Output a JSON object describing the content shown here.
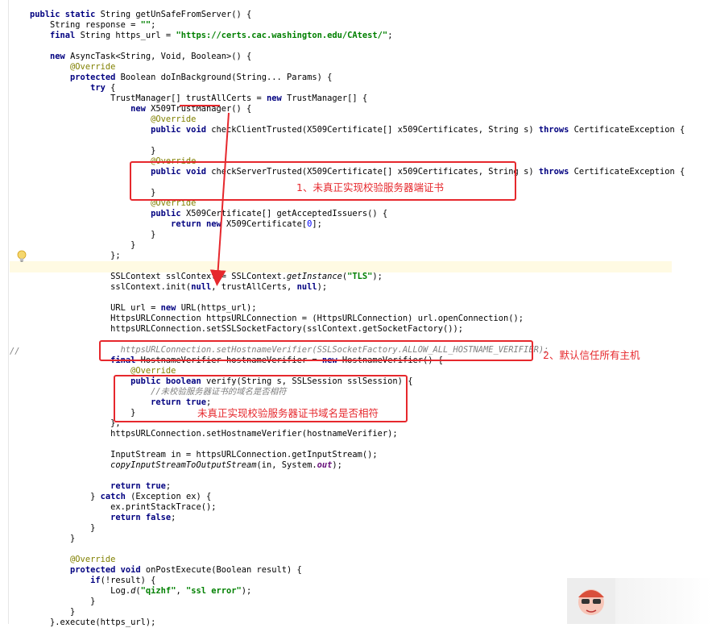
{
  "code_lines": [
    {
      "segments": [
        {
          "t": "public static ",
          "c": "kw"
        },
        {
          "t": "String getUnSafeFromServer() {",
          "c": ""
        }
      ]
    },
    {
      "segments": [
        {
          "t": "    String response = ",
          "c": ""
        },
        {
          "t": "\"\"",
          "c": "str"
        },
        {
          "t": ";",
          "c": ""
        }
      ]
    },
    {
      "segments": [
        {
          "t": "    ",
          "c": ""
        },
        {
          "t": "final ",
          "c": "kw"
        },
        {
          "t": "String https_url = ",
          "c": ""
        },
        {
          "t": "\"https://certs.cac.washington.edu/CAtest/\"",
          "c": "str"
        },
        {
          "t": ";",
          "c": ""
        }
      ]
    },
    {
      "segments": [
        {
          "t": "",
          "c": ""
        }
      ]
    },
    {
      "segments": [
        {
          "t": "    ",
          "c": ""
        },
        {
          "t": "new ",
          "c": "kw"
        },
        {
          "t": "AsyncTask<String, Void, Boolean>() {",
          "c": ""
        }
      ]
    },
    {
      "segments": [
        {
          "t": "        ",
          "c": ""
        },
        {
          "t": "@Override",
          "c": "anno"
        }
      ]
    },
    {
      "segments": [
        {
          "t": "        ",
          "c": ""
        },
        {
          "t": "protected ",
          "c": "kw"
        },
        {
          "t": "Boolean doInBackground(String... Params) {",
          "c": ""
        }
      ]
    },
    {
      "segments": [
        {
          "t": "            ",
          "c": ""
        },
        {
          "t": "try ",
          "c": "kw"
        },
        {
          "t": "{",
          "c": ""
        }
      ]
    },
    {
      "segments": [
        {
          "t": "                TrustManager[] trustAllCerts = ",
          "c": ""
        },
        {
          "t": "new ",
          "c": "kw"
        },
        {
          "t": "TrustManager[] {",
          "c": ""
        }
      ]
    },
    {
      "segments": [
        {
          "t": "                    ",
          "c": ""
        },
        {
          "t": "new ",
          "c": "kw"
        },
        {
          "t": "X509TrustManager() {",
          "c": ""
        }
      ]
    },
    {
      "segments": [
        {
          "t": "                        ",
          "c": ""
        },
        {
          "t": "@Override",
          "c": "anno"
        }
      ]
    },
    {
      "segments": [
        {
          "t": "                        ",
          "c": ""
        },
        {
          "t": "public void ",
          "c": "kw"
        },
        {
          "t": "checkClientTrusted(X509Certificate[] x509Certificates, String s) ",
          "c": ""
        },
        {
          "t": "throws ",
          "c": "kw"
        },
        {
          "t": "CertificateException {",
          "c": ""
        }
      ]
    },
    {
      "segments": [
        {
          "t": "",
          "c": ""
        }
      ]
    },
    {
      "segments": [
        {
          "t": "                        }",
          "c": ""
        }
      ]
    },
    {
      "segments": [
        {
          "t": "                        ",
          "c": ""
        },
        {
          "t": "@Override",
          "c": "anno"
        }
      ]
    },
    {
      "segments": [
        {
          "t": "                        ",
          "c": ""
        },
        {
          "t": "public void ",
          "c": "kw"
        },
        {
          "t": "checkServerTrusted(X509Certificate[] x509Certificates, String s) ",
          "c": ""
        },
        {
          "t": "throws ",
          "c": "kw"
        },
        {
          "t": "CertificateException {",
          "c": ""
        }
      ]
    },
    {
      "segments": [
        {
          "t": "",
          "c": ""
        }
      ]
    },
    {
      "segments": [
        {
          "t": "                        }",
          "c": ""
        }
      ]
    },
    {
      "segments": [
        {
          "t": "                        ",
          "c": ""
        },
        {
          "t": "@Override",
          "c": "anno"
        }
      ]
    },
    {
      "segments": [
        {
          "t": "                        ",
          "c": ""
        },
        {
          "t": "public ",
          "c": "kw"
        },
        {
          "t": "X509Certificate[] getAcceptedIssuers() {",
          "c": ""
        }
      ]
    },
    {
      "segments": [
        {
          "t": "                            ",
          "c": ""
        },
        {
          "t": "return new ",
          "c": "kw"
        },
        {
          "t": "X509Certificate[",
          "c": ""
        },
        {
          "t": "0",
          "c": "num"
        },
        {
          "t": "];",
          "c": ""
        }
      ]
    },
    {
      "segments": [
        {
          "t": "                        }",
          "c": ""
        }
      ]
    },
    {
      "segments": [
        {
          "t": "                    }",
          "c": ""
        }
      ]
    },
    {
      "segments": [
        {
          "t": "                };",
          "c": ""
        }
      ]
    },
    {
      "segments": [
        {
          "t": "",
          "c": ""
        }
      ]
    },
    {
      "segments": [
        {
          "t": "                SSLContext sslContext = SSLContext.",
          "c": ""
        },
        {
          "t": "getInstance",
          "c": "it"
        },
        {
          "t": "(",
          "c": ""
        },
        {
          "t": "\"TLS\"",
          "c": "str"
        },
        {
          "t": ");",
          "c": ""
        }
      ]
    },
    {
      "segments": [
        {
          "t": "                sslContext.init(",
          "c": ""
        },
        {
          "t": "null",
          "c": "kw"
        },
        {
          "t": ", trustAllCerts, ",
          "c": ""
        },
        {
          "t": "null",
          "c": "kw"
        },
        {
          "t": ");",
          "c": ""
        }
      ]
    },
    {
      "segments": [
        {
          "t": "",
          "c": ""
        }
      ]
    },
    {
      "segments": [
        {
          "t": "                URL url = ",
          "c": ""
        },
        {
          "t": "new ",
          "c": "kw"
        },
        {
          "t": "URL(https_url);",
          "c": ""
        }
      ]
    },
    {
      "segments": [
        {
          "t": "                HttpsURLConnection httpsURLConnection = (HttpsURLConnection) url.openConnection();",
          "c": ""
        }
      ]
    },
    {
      "segments": [
        {
          "t": "                httpsURLConnection.setSSLSocketFactory(sslContext.getSocketFactory());",
          "c": ""
        }
      ]
    },
    {
      "segments": [
        {
          "t": "",
          "c": ""
        }
      ]
    },
    {
      "segments": [
        {
          "t": "                  httpsURLConnection.setHostnameVerifier(SSLSocketFactory.ALLOW_ALL_HOSTNAME_VERIFIER);",
          "c": "cmt"
        }
      ]
    },
    {
      "segments": [
        {
          "t": "                ",
          "c": ""
        },
        {
          "t": "final ",
          "c": "kw"
        },
        {
          "t": "HostnameVerifier hostnameVerifier = ",
          "c": ""
        },
        {
          "t": "new ",
          "c": "kw"
        },
        {
          "t": "HostnameVerifier() {",
          "c": ""
        }
      ]
    },
    {
      "segments": [
        {
          "t": "                    ",
          "c": ""
        },
        {
          "t": "@Override",
          "c": "anno"
        }
      ]
    },
    {
      "segments": [
        {
          "t": "                    ",
          "c": ""
        },
        {
          "t": "public boolean ",
          "c": "kw"
        },
        {
          "t": "verify(String s, SSLSession sslSession) {",
          "c": ""
        }
      ]
    },
    {
      "segments": [
        {
          "t": "                        ",
          "c": ""
        },
        {
          "t": "//未校验服务器证书的域名是否相符",
          "c": "cmt"
        }
      ]
    },
    {
      "segments": [
        {
          "t": "                        ",
          "c": ""
        },
        {
          "t": "return true",
          "c": "kw"
        },
        {
          "t": ";",
          "c": ""
        }
      ]
    },
    {
      "segments": [
        {
          "t": "                    }",
          "c": ""
        }
      ]
    },
    {
      "segments": [
        {
          "t": "                };",
          "c": ""
        }
      ]
    },
    {
      "segments": [
        {
          "t": "                httpsURLConnection.setHostnameVerifier(hostnameVerifier);",
          "c": ""
        }
      ]
    },
    {
      "segments": [
        {
          "t": "",
          "c": ""
        }
      ]
    },
    {
      "segments": [
        {
          "t": "                InputStream in = httpsURLConnection.getInputStream();",
          "c": ""
        }
      ]
    },
    {
      "segments": [
        {
          "t": "                ",
          "c": ""
        },
        {
          "t": "copyInputStreamToOutputStream",
          "c": "it"
        },
        {
          "t": "(in, System.",
          "c": ""
        },
        {
          "t": "out",
          "c": "field"
        },
        {
          "t": ");",
          "c": ""
        }
      ]
    },
    {
      "segments": [
        {
          "t": "",
          "c": ""
        }
      ]
    },
    {
      "segments": [
        {
          "t": "                ",
          "c": ""
        },
        {
          "t": "return true",
          "c": "kw"
        },
        {
          "t": ";",
          "c": ""
        }
      ]
    },
    {
      "segments": [
        {
          "t": "            } ",
          "c": ""
        },
        {
          "t": "catch ",
          "c": "kw"
        },
        {
          "t": "(Exception ex) {",
          "c": ""
        }
      ]
    },
    {
      "segments": [
        {
          "t": "                ex.printStackTrace();",
          "c": ""
        }
      ]
    },
    {
      "segments": [
        {
          "t": "                ",
          "c": ""
        },
        {
          "t": "return false",
          "c": "kw"
        },
        {
          "t": ";",
          "c": ""
        }
      ]
    },
    {
      "segments": [
        {
          "t": "            }",
          "c": ""
        }
      ]
    },
    {
      "segments": [
        {
          "t": "        }",
          "c": ""
        }
      ]
    },
    {
      "segments": [
        {
          "t": "",
          "c": ""
        }
      ]
    },
    {
      "segments": [
        {
          "t": "        ",
          "c": ""
        },
        {
          "t": "@Override",
          "c": "anno"
        }
      ]
    },
    {
      "segments": [
        {
          "t": "        ",
          "c": ""
        },
        {
          "t": "protected void ",
          "c": "kw"
        },
        {
          "t": "onPostExecute(Boolean result) {",
          "c": ""
        }
      ]
    },
    {
      "segments": [
        {
          "t": "            ",
          "c": ""
        },
        {
          "t": "if",
          "c": "kw"
        },
        {
          "t": "(!result) {",
          "c": ""
        }
      ]
    },
    {
      "segments": [
        {
          "t": "                Log.",
          "c": ""
        },
        {
          "t": "d",
          "c": "it"
        },
        {
          "t": "(",
          "c": ""
        },
        {
          "t": "\"qizhf\"",
          "c": "str"
        },
        {
          "t": ", ",
          "c": ""
        },
        {
          "t": "\"ssl error\"",
          "c": "str"
        },
        {
          "t": ");",
          "c": ""
        }
      ]
    },
    {
      "segments": [
        {
          "t": "            }",
          "c": ""
        }
      ]
    },
    {
      "segments": [
        {
          "t": "        }",
          "c": ""
        }
      ]
    },
    {
      "segments": [
        {
          "t": "    }.execute(https_url);",
          "c": ""
        }
      ]
    }
  ],
  "gutter_comment_marker": "//",
  "annotations": {
    "callout1": "1、未真正实现校验服务器端证书",
    "callout2": "2、默认信任所有主机",
    "callout3": "未真正实现校验服务器证书域名是否相符"
  },
  "colors": {
    "keyword": "#000080",
    "string": "#008000",
    "annotation": "#808000",
    "comment": "#808080",
    "callout": "#e6282d"
  }
}
